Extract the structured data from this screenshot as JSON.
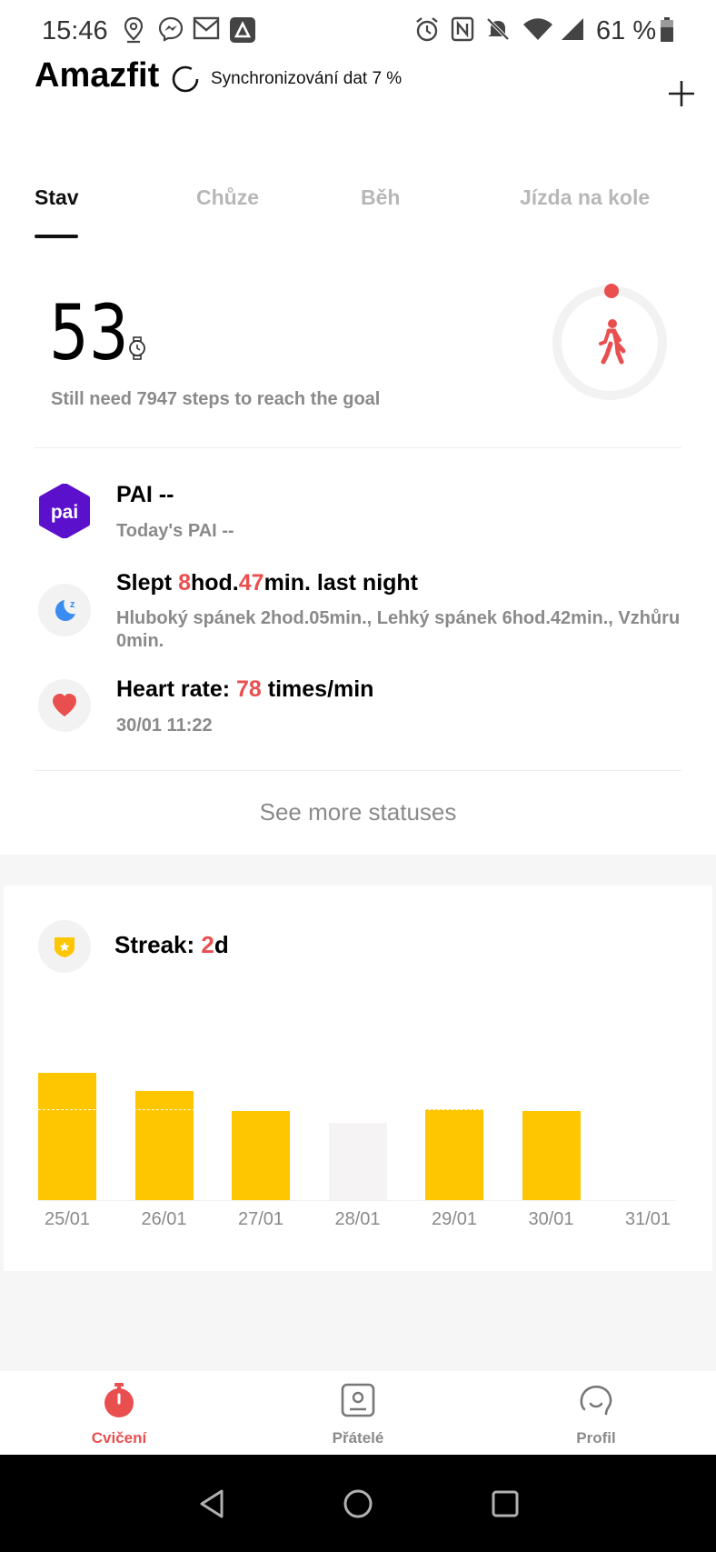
{
  "status_bar": {
    "time": "15:46",
    "battery": "61 %",
    "icons": [
      "location-icon",
      "messenger-icon",
      "gmail-icon",
      "app-icon",
      "alarm-icon",
      "nfc-icon",
      "mute-icon",
      "wifi-icon",
      "signal-icon",
      "battery-icon"
    ]
  },
  "header": {
    "brand": "Amazfit",
    "sync_text": "Synchronizování dat 7 %",
    "add_icon": "plus-icon"
  },
  "tabs": [
    {
      "label": "Stav",
      "active": true
    },
    {
      "label": "Chůze",
      "active": false
    },
    {
      "label": "Běh",
      "active": false
    },
    {
      "label": "Jízda na kole",
      "active": false
    }
  ],
  "steps": {
    "value": "53",
    "subtitle": "Still need 7947 steps to reach the goal",
    "goal_progress": 0.0066
  },
  "pai": {
    "title": "PAI --",
    "subtitle": "Today's PAI --",
    "icon_text": "pai"
  },
  "sleep": {
    "prefix": "Slept ",
    "hours": "8",
    "hours_unit": "hod.",
    "minutes": "47",
    "suffix": "min. last night",
    "details": "Hluboký spánek 2hod.05min., Lehký spánek 6hod.42min., Vzhůru 0min."
  },
  "heart": {
    "prefix": "Heart rate: ",
    "value": "78",
    "suffix": " times/min",
    "time": "30/01 11:22"
  },
  "see_more": "See more statuses",
  "streak": {
    "prefix": "Streak: ",
    "value": "2",
    "suffix": "d"
  },
  "chart_data": {
    "type": "bar",
    "categories": [
      "25/01",
      "26/01",
      "27/01",
      "28/01",
      "29/01",
      "30/01",
      "31/01"
    ],
    "values": [
      1.4,
      1.2,
      0.98,
      0.85,
      1.0,
      0.98,
      0
    ],
    "goal_reached": [
      true,
      true,
      true,
      false,
      true,
      true,
      false
    ],
    "goal": 1.0,
    "ylim": [
      0,
      1.5
    ]
  },
  "bottom_nav": [
    {
      "label": "Cvičení",
      "icon": "stopwatch-icon",
      "active": true
    },
    {
      "label": "Přátelé",
      "icon": "friends-icon",
      "active": false
    },
    {
      "label": "Profil",
      "icon": "profile-icon",
      "active": false
    }
  ],
  "colors": {
    "accent": "#e94f4f",
    "bar_done": "#fdc600",
    "bar_miss": "#f5f3f4",
    "pai_purple": "#5b10cc",
    "sleep_blue": "#3b8cf0"
  }
}
